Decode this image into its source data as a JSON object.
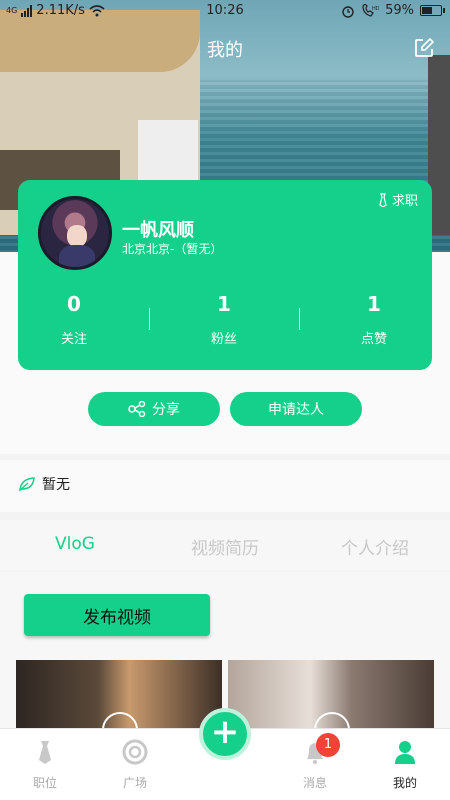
{
  "status_bar": {
    "network": "4G",
    "speed": "2.11K/s",
    "time": "10:26",
    "battery": "59%",
    "battery_level": 0.59
  },
  "header": {
    "title": "我的"
  },
  "profile": {
    "job_label": "求职",
    "name": "一帆风顺",
    "location": "北京北京-（暂无）",
    "stats": [
      {
        "value": "0",
        "label": "关注"
      },
      {
        "value": "1",
        "label": "粉丝"
      },
      {
        "value": "1",
        "label": "点赞"
      }
    ]
  },
  "actions": {
    "share": "分享",
    "apply": "申请达人"
  },
  "tag": {
    "text": "暂无"
  },
  "tabs": [
    {
      "label": "VloG",
      "active": true
    },
    {
      "label": "视频简历",
      "active": false
    },
    {
      "label": "个人介绍",
      "active": false
    }
  ],
  "publish_label": "发布视频",
  "bottom_nav": {
    "items": [
      {
        "label": "职位"
      },
      {
        "label": "广场"
      },
      {
        "label": "消息"
      },
      {
        "label": "我的"
      }
    ],
    "message_badge": "1"
  },
  "colors": {
    "accent": "#14d08a",
    "badge": "#f44336"
  }
}
